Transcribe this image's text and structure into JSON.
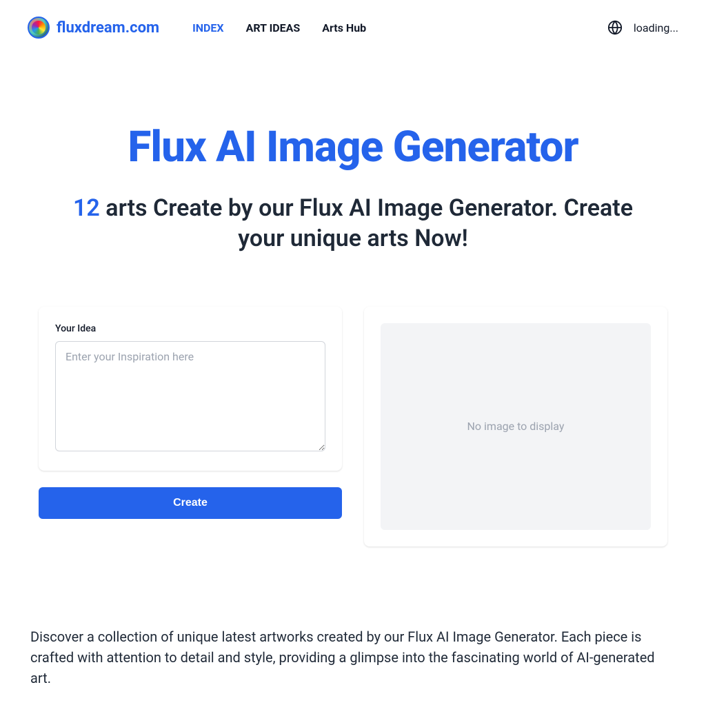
{
  "header": {
    "brand": "fluxdream.com",
    "nav": {
      "index": "INDEX",
      "art_ideas": "ART IDEAS",
      "arts_hub": "Arts Hub"
    },
    "loading": "loading..."
  },
  "hero": {
    "title": "Flux AI Image Generator",
    "count": "12",
    "subtitle_rest": " arts Create by our Flux AI Image Generator. Create your unique arts Now!"
  },
  "form": {
    "label": "Your Idea",
    "placeholder": "Enter your Inspiration here",
    "button": "Create"
  },
  "preview": {
    "empty": "No image to display"
  },
  "description": "Discover a collection of unique latest artworks created by our Flux AI Image Generator. Each piece is crafted with attention to detail and style, providing a glimpse into the fascinating world of AI-generated art."
}
